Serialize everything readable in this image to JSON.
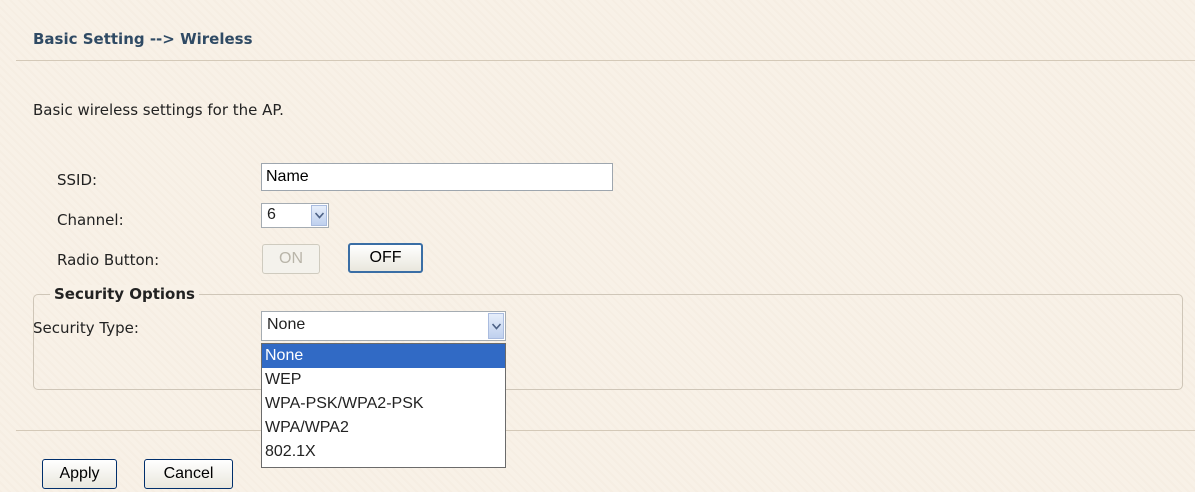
{
  "header": {
    "breadcrumb": "Basic Setting --> Wireless"
  },
  "description": "Basic wireless settings for the AP.",
  "ssid": {
    "label": "SSID:",
    "value": "Name"
  },
  "channel": {
    "label": "Channel:",
    "value": "6"
  },
  "radio": {
    "label": "Radio Button:",
    "on_label": "ON",
    "off_label": "OFF"
  },
  "security": {
    "legend": "Security Options",
    "type_label": "Security Type:",
    "type_value": "None",
    "options": [
      "None",
      "WEP",
      "WPA-PSK/WPA2-PSK",
      "WPA/WPA2",
      "802.1X"
    ]
  },
  "actions": {
    "apply": "Apply",
    "cancel": "Cancel"
  },
  "colors": {
    "background": "#f8f1e7",
    "heading": "#2f4a64",
    "selected_option": "#316ac5"
  },
  "icons": {
    "select_arrow": "chevron-down-icon"
  }
}
